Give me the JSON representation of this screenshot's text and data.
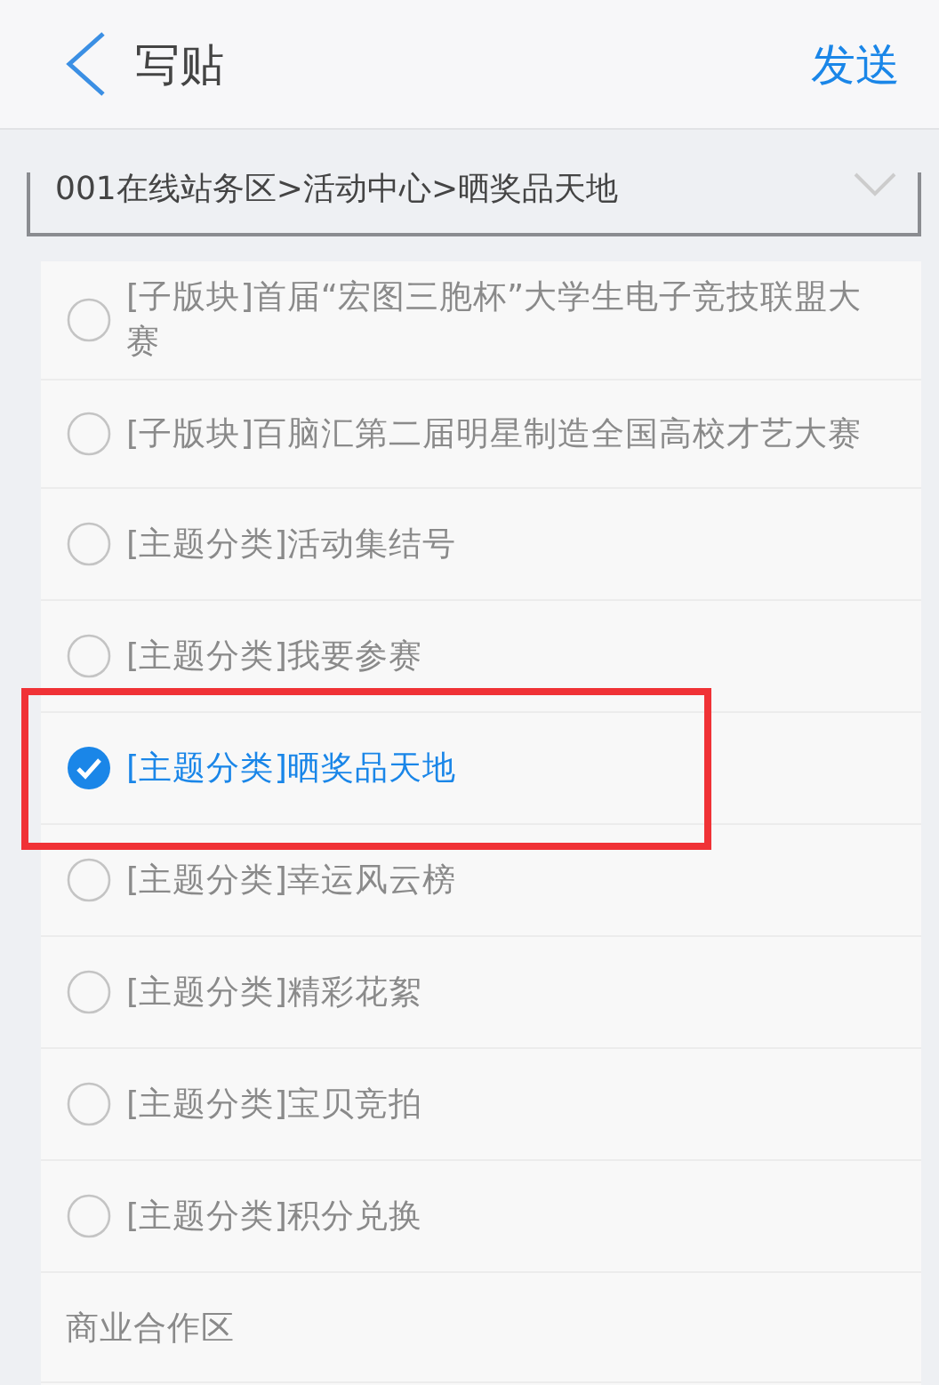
{
  "header": {
    "title": "写贴",
    "action": "发送"
  },
  "forum_path": "001在线站务区>活动中心>晒奖品天地",
  "options": [
    {
      "kind": "option",
      "label": "[子版块]首届“宏图三胞杯”大学生电子竞技联盟大赛",
      "selected": false,
      "annotated": false
    },
    {
      "kind": "option",
      "label": "[子版块]百脑汇第二届明星制造全国高校才艺大赛",
      "selected": false,
      "annotated": false
    },
    {
      "kind": "option",
      "label": "[主题分类]活动集结号",
      "selected": false,
      "annotated": false
    },
    {
      "kind": "option",
      "label": "[主题分类]我要参赛",
      "selected": false,
      "annotated": false
    },
    {
      "kind": "option",
      "label": "[主题分类]晒奖品天地",
      "selected": true,
      "annotated": true
    },
    {
      "kind": "option",
      "label": "[主题分类]幸运风云榜",
      "selected": false,
      "annotated": false
    },
    {
      "kind": "option",
      "label": "[主题分类]精彩花絮",
      "selected": false,
      "annotated": false
    },
    {
      "kind": "option",
      "label": "[主题分类]宝贝竞拍",
      "selected": false,
      "annotated": false
    },
    {
      "kind": "option",
      "label": "[主题分类]积分兑换",
      "selected": false,
      "annotated": false
    },
    {
      "kind": "section",
      "label": "商业合作区"
    }
  ]
}
